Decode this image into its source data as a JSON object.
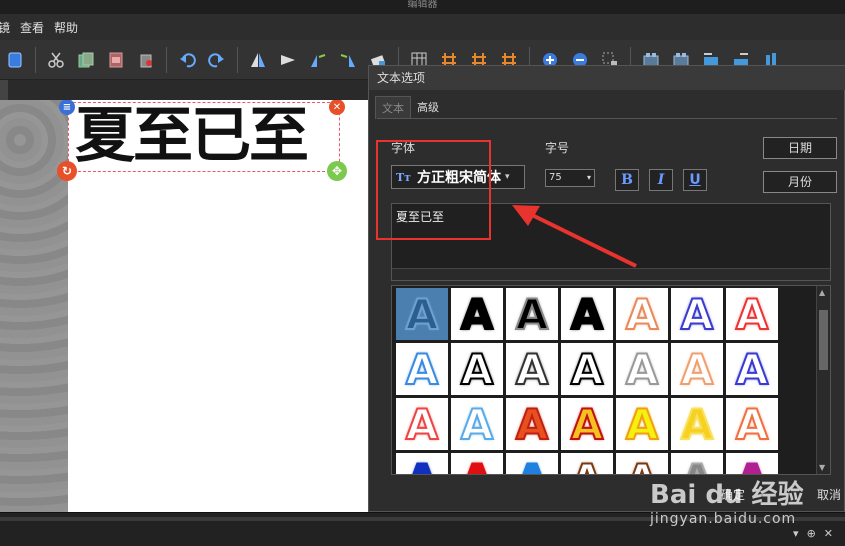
{
  "window": {
    "title": "编辑器"
  },
  "menu": [
    "镜",
    "查看",
    "帮助"
  ],
  "toolbar": {
    "icons": [
      "new-icon",
      "cut-icon",
      "copy-icon",
      "paste-icon",
      "delete-icon",
      "undo-icon",
      "redo-icon",
      "flip-h-icon",
      "flip-v-icon",
      "rotate-left-icon",
      "rotate-right-icon",
      "eraser-icon",
      "grid-icon",
      "align-icon",
      "align-icon",
      "align-icon",
      "zoom-in-icon",
      "zoom-out-icon",
      "select-icon",
      "group-icon",
      "ungroup-icon",
      "layout-icon",
      "layout-icon",
      "layout-icon"
    ]
  },
  "canvas": {
    "text_object": "夏至已至"
  },
  "dialog": {
    "title": "文本选项",
    "tabs": [
      {
        "label": "文本",
        "active": true
      },
      {
        "label": "高级",
        "active": false
      }
    ],
    "font_label": "字体",
    "font_value": "方正粗宋简体",
    "size_label": "字号",
    "size_value": "75",
    "bold": "B",
    "italic": "I",
    "underline": "U",
    "date_button": "日期",
    "month_button": "月份",
    "text_value": "夏至已至",
    "ok_button": "确定",
    "cancel_button": "取消"
  },
  "styles_gallery": {
    "glyph": "A",
    "rows": [
      [
        {
          "fill": "#2a5f8f",
          "stroke": "#6fa0d0",
          "bg": "#4a7fb0"
        },
        {
          "fill": "#000",
          "stroke": "#000",
          "bg": "#fff"
        },
        {
          "fill": "#000",
          "stroke": "#888",
          "bg": "#fff"
        },
        {
          "fill": "#000",
          "stroke": "#000",
          "bg": "#fff"
        },
        {
          "fill": "#fff",
          "stroke": "#e88a5a",
          "bg": "#fff"
        },
        {
          "fill": "#fff",
          "stroke": "#3a3acc",
          "bg": "#fff"
        },
        {
          "fill": "#fff",
          "stroke": "#e33",
          "bg": "#fff"
        }
      ],
      [
        {
          "fill": "#fff",
          "stroke": "#3a8ae0",
          "bg": "#fff"
        },
        {
          "fill": "#fff",
          "stroke": "#000",
          "bg": "#fff"
        },
        {
          "fill": "#fff",
          "stroke": "#333",
          "bg": "#fff"
        },
        {
          "fill": "#fff",
          "stroke": "#000",
          "bg": "#fff"
        },
        {
          "fill": "#fff",
          "stroke": "#999",
          "bg": "#fff"
        },
        {
          "fill": "#fff",
          "stroke": "#f0a070",
          "bg": "#fff"
        },
        {
          "fill": "#fff",
          "stroke": "#3a3ad0",
          "bg": "#fff"
        }
      ],
      [
        {
          "fill": "#fff",
          "stroke": "#e44",
          "bg": "#fff"
        },
        {
          "fill": "#fff",
          "stroke": "#5aaae8",
          "bg": "#fff"
        },
        {
          "fill": "#e85020",
          "stroke": "#c02010",
          "bg": "#fff"
        },
        {
          "fill": "#f5c020",
          "stroke": "#c01010",
          "bg": "#fff"
        },
        {
          "fill": "#f5f010",
          "stroke": "#f0a010",
          "bg": "#fff"
        },
        {
          "fill": "#f8d020",
          "stroke": "#f8e060",
          "bg": "#fff"
        },
        {
          "fill": "#fff",
          "stroke": "#f07040",
          "bg": "#fff"
        }
      ],
      [
        {
          "fill": "#1030c0",
          "stroke": "#1030c0",
          "bg": "#fff"
        },
        {
          "fill": "#e01010",
          "stroke": "#e01010",
          "bg": "#fff"
        },
        {
          "fill": "#2080e0",
          "stroke": "#2080e0",
          "bg": "#fff"
        },
        {
          "fill": "#fff",
          "stroke": "#7a3a10",
          "bg": "#fff"
        },
        {
          "fill": "#fff",
          "stroke": "#7a3a10",
          "bg": "#fff"
        },
        {
          "fill": "#888",
          "stroke": "#aaa",
          "bg": "#fff"
        },
        {
          "fill": "#b02090",
          "stroke": "#b02090",
          "bg": "#fff"
        }
      ]
    ]
  },
  "statusbar": {
    "buttons": [
      "▾",
      "⊕",
      "✕"
    ]
  },
  "watermark": {
    "logo": "Bai du 经验",
    "url": "jingyan.baidu.com"
  }
}
